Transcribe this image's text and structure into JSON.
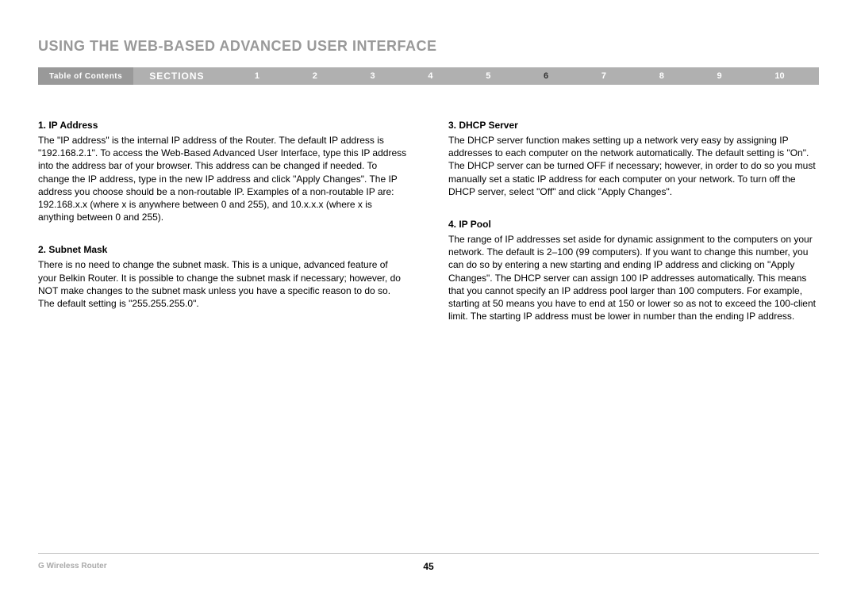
{
  "page_title": "USING THE WEB-BASED ADVANCED USER INTERFACE",
  "nav": {
    "toc": "Table of Contents",
    "sections_label": "SECTIONS",
    "numbers": [
      "1",
      "2",
      "3",
      "4",
      "5",
      "6",
      "7",
      "8",
      "9",
      "10"
    ],
    "active": "6"
  },
  "left_column": [
    {
      "heading": "1.    IP Address",
      "text": "The \"IP address\" is the internal IP address of the Router. The default IP address is \"192.168.2.1\". To access the Web-Based Advanced User Interface, type this IP address into the address bar of your browser. This address can be changed if needed. To change the IP address, type in the new IP address and click \"Apply Changes\". The IP address you choose should be a non-routable IP. Examples of a non-routable IP are: 192.168.x.x (where x is anywhere between 0 and 255), and 10.x.x.x (where x is anything between 0 and 255)."
    },
    {
      "heading": "2.    Subnet Mask",
      "text": "There is no need to change the subnet mask. This is a unique, advanced feature of your Belkin Router. It is possible to change the subnet mask if necessary; however, do NOT make changes to the subnet mask unless you have a specific reason to do so. The default setting is \"255.255.255.0\"."
    }
  ],
  "right_column": [
    {
      "heading": "3.    DHCP Server",
      "text": "The DHCP server function makes setting up a network very easy by assigning IP addresses to each computer on the network automatically. The default setting is \"On\". The DHCP server can be turned OFF if necessary; however, in order to do so you must manually set a static IP address for each computer on your network. To turn off the DHCP server, select \"Off\" and click \"Apply Changes\"."
    },
    {
      "heading": "4.    IP Pool",
      "text": "The range of IP addresses set aside for dynamic assignment to the computers on your network. The default is 2–100 (99 computers). If you want to change this number, you can do so by entering a new starting and ending IP address and clicking on \"Apply Changes\". The DHCP server can assign 100 IP addresses automatically. This means that you cannot specify an IP address pool larger than 100 computers. For example, starting at 50 means you have to end at 150 or lower so as not to exceed the 100-client limit. The starting IP address must be lower in number than the ending IP address."
    }
  ],
  "footer": {
    "product": "G Wireless Router",
    "page_number": "45"
  }
}
